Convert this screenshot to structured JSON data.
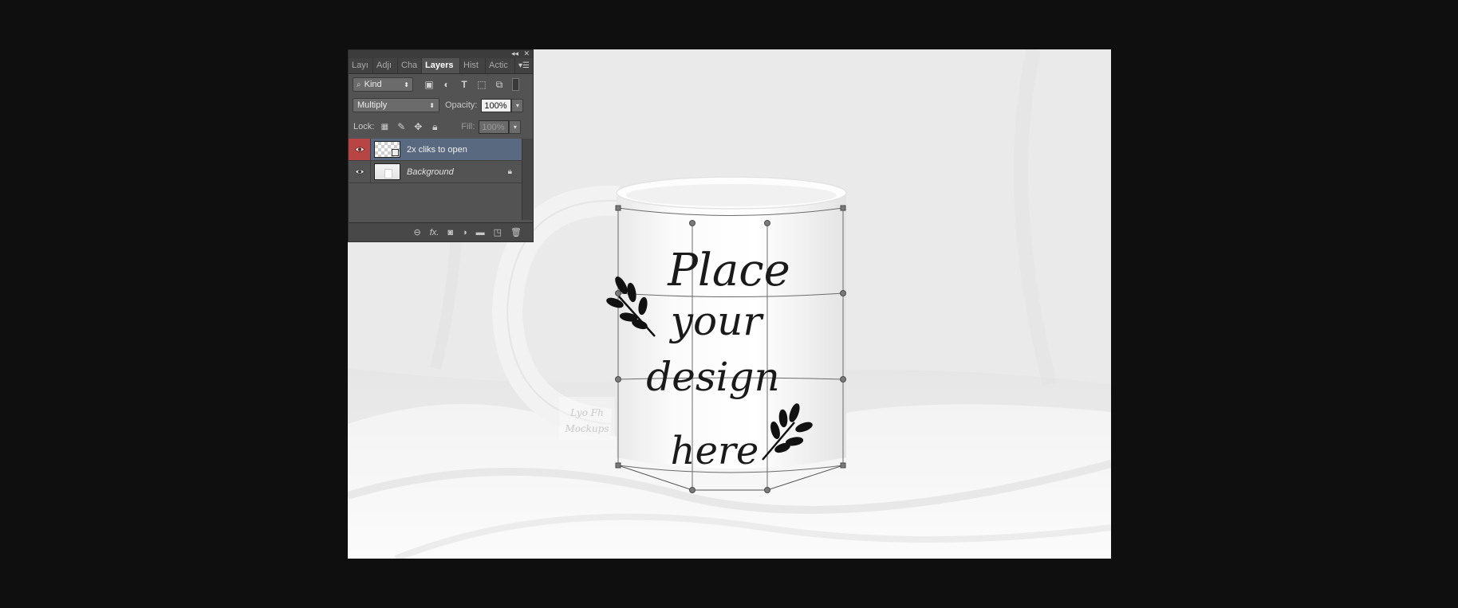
{
  "panel": {
    "tabs": [
      {
        "label": "Layı",
        "active": false
      },
      {
        "label": "Adjı",
        "active": false
      },
      {
        "label": "Cha",
        "active": false
      },
      {
        "label": "Layers",
        "active": true
      },
      {
        "label": "Hist",
        "active": false
      },
      {
        "label": "Actic",
        "active": false
      }
    ],
    "filter": {
      "label": "Kind"
    },
    "blend_mode": "Multiply",
    "opacity_label": "Opacity:",
    "opacity_value": "100%",
    "lock_label": "Lock:",
    "fill_label": "Fill:",
    "fill_value": "100%",
    "layers": [
      {
        "name": "2x cliks to open",
        "selected": true,
        "visible": true
      },
      {
        "name": "Background",
        "selected": false,
        "visible": true,
        "locked": true
      }
    ]
  },
  "canvas": {
    "design_text": [
      "Place",
      "your",
      "design",
      "here"
    ],
    "watermark": [
      "Lyo Fh",
      "Mockups"
    ]
  },
  "colors": {
    "panel_bg": "#535353",
    "selected_layer": "#59697f",
    "eye_active": "#b94444",
    "background": "#0f0f0f"
  }
}
